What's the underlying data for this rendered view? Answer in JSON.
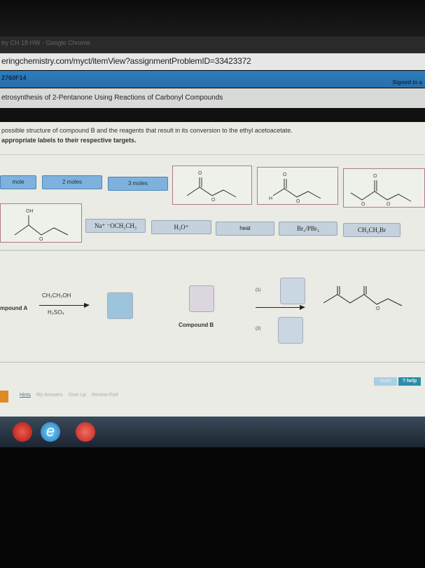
{
  "browser": {
    "window_title": "try CH 18 HW - Google Chrome",
    "url": "eringchemistry.com/myct/itemView?assignmentProblemID=33423372"
  },
  "course_bar": {
    "course_id": "2760F14",
    "signed_in": "Signed in a"
  },
  "problem": {
    "title": "etrosynthesis of 2-Pentanone Using Reactions of Carbonyl Compounds",
    "instruction1": "possible structure of compound B and the reagents that result in its conversion to the ethyl acetoacetate.",
    "instruction2": "appropriate labels to their respective targets."
  },
  "labels": {
    "mole": "mole",
    "moles2": "2 moles",
    "moles3": "3 moles",
    "naoet": "Na⁺ ⁻OCH₂CH₃",
    "h3o": "H₃O⁺",
    "heat": "heat",
    "br2": "Br₂/PBr₃",
    "etbr": "CH₃CH₂Br"
  },
  "structures": {
    "o": "O",
    "oh": "OH",
    "h": "H"
  },
  "diagram": {
    "compound_a": "mpound A",
    "reagent_top": "CH₂CH₂OH",
    "reagent_bottom": "H₂SO₄",
    "compound_b": "Compound B",
    "step1": "(1)",
    "step2": "(2)"
  },
  "buttons": {
    "reset": "reset",
    "help": "? help"
  },
  "footer_links": [
    "Hints",
    "My Answers",
    "Give Up",
    "Review Part"
  ]
}
